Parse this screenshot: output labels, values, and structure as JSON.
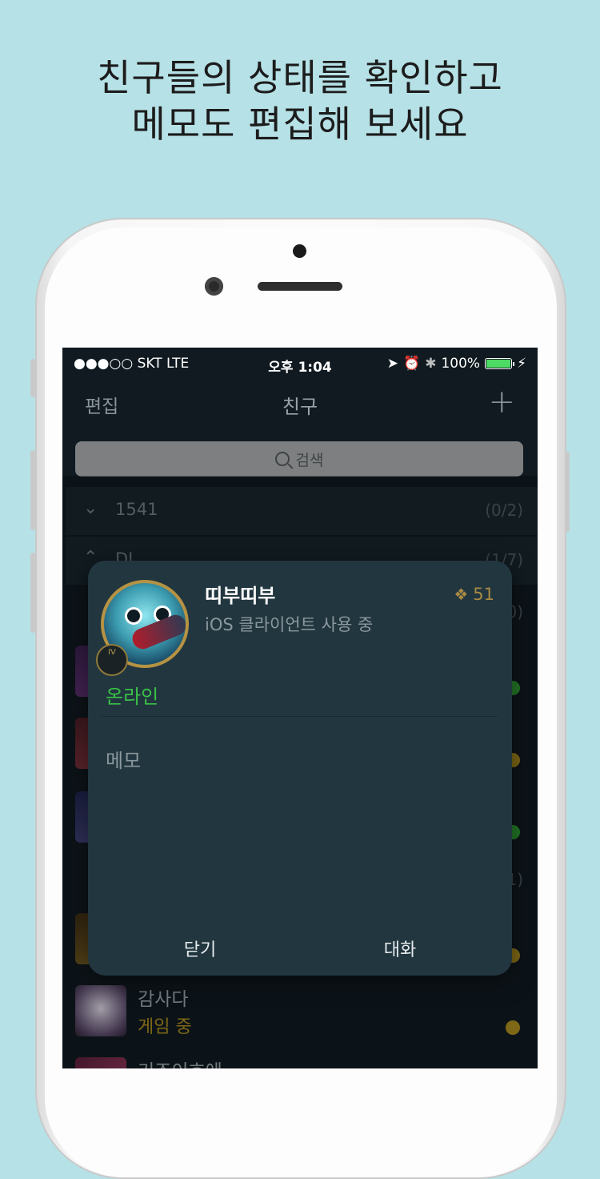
{
  "headline": {
    "line1": "친구들의 상태를 확인하고",
    "line2": "메모도 편집해 보세요"
  },
  "statusbar": {
    "carrier": "●●●○○ SKT   LTE",
    "time": "오후 1:04",
    "battery_text": "100%",
    "battery_level": 1.0,
    "icons": [
      "location-arrow-icon",
      "alarm-icon",
      "bluetooth-icon",
      "battery-icon",
      "charging-bolt-icon"
    ]
  },
  "navbar": {
    "edit_label": "편집",
    "title": "친구",
    "add_icon": "plus-icon"
  },
  "search": {
    "placeholder": "검색",
    "icon": "search-icon"
  },
  "groups": [
    {
      "name": "1541",
      "count": "(0/2)",
      "expanded": false
    },
    {
      "name": "DJ",
      "count": "(1/7)",
      "expanded": true
    }
  ],
  "visible_list": {
    "partial_counts": [
      "0)",
      "1)"
    ],
    "friend": {
      "name": "감사다",
      "status": "게임 중"
    },
    "partial_name": "기조이흐에"
  },
  "popup": {
    "name": "띠부띠부",
    "client": "iOS 클라이언트 사용 중",
    "level": "51",
    "rank_badge": "IV",
    "status": "온라인",
    "memo_label": "메모",
    "close_button": "닫기",
    "chat_button": "대화"
  },
  "colors": {
    "background": "#b6e1e6",
    "online": "#39c247",
    "in_game": "#a88a1e",
    "popup_bg": "#22363f"
  }
}
